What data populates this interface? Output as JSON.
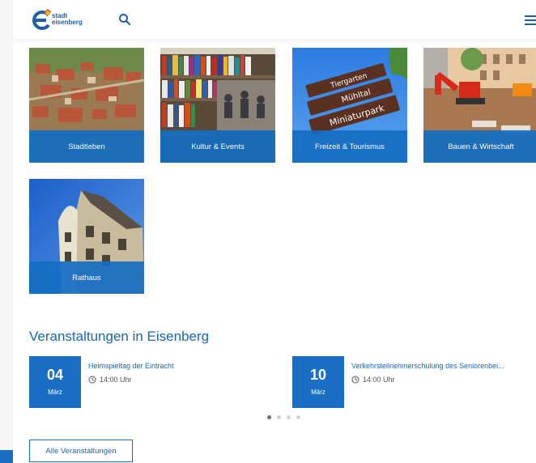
{
  "header": {
    "logo_line1": "stadt",
    "logo_line2": "eisenberg",
    "icons": [
      "logo-e-icon",
      "search-icon",
      "menu-icon"
    ]
  },
  "tiles": [
    {
      "label": "Stadtleben"
    },
    {
      "label": "Kultur & Events"
    },
    {
      "label": "Freizeit & Tourismus"
    },
    {
      "label": "Bauen & Wirtschaft"
    },
    {
      "label": "Rathaus"
    }
  ],
  "sign_texts": [
    "Tiergarten",
    "Mühltal",
    "Miniaturpark"
  ],
  "events_section": {
    "title": "Veranstaltungen in Eisenberg",
    "events": [
      {
        "day": "04",
        "month": "März",
        "title": "Heimspieltag der Eintracht",
        "time": "14:00 Uhr"
      },
      {
        "day": "10",
        "month": "März",
        "title": "Verkehrsteilnehmerschulung des Seniorenbei...",
        "time": "14:00 Uhr"
      }
    ],
    "carousel_pages": 4,
    "carousel_active": 1,
    "all_button": "Alle Veranstaltungen"
  },
  "colors": {
    "primary": "#1a6fc4",
    "title_blue": "#1967b6",
    "tile_overlay": "#146ec3"
  }
}
